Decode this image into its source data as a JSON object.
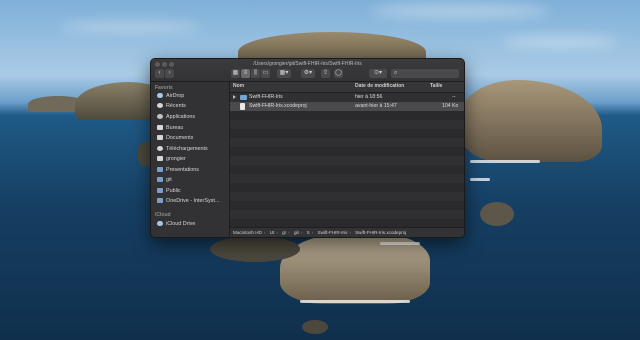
{
  "window": {
    "title": "/Users/grongier/git/Swift-FHIR-Iris/Swift-FHIR-Iris"
  },
  "sidebar": {
    "favorites_header": "Favoris",
    "favorites": [
      {
        "label": "AirDrop",
        "icon": "airdrop-icon"
      },
      {
        "label": "Récents",
        "icon": "clock-icon"
      },
      {
        "label": "Applications",
        "icon": "applications-icon"
      },
      {
        "label": "Bureau",
        "icon": "desktop-icon"
      },
      {
        "label": "Documents",
        "icon": "document-icon"
      },
      {
        "label": "Téléchargements",
        "icon": "download-icon"
      },
      {
        "label": "grongier",
        "icon": "home-icon"
      },
      {
        "label": "Presentations",
        "icon": "folder-icon"
      },
      {
        "label": "git",
        "icon": "folder-icon"
      },
      {
        "label": "Public",
        "icon": "folder-icon"
      },
      {
        "label": "OneDrive - InterSyst...",
        "icon": "cloud-icon"
      }
    ],
    "icloud_header": "iCloud",
    "icloud": [
      {
        "label": "iCloud Drive",
        "icon": "cloud-icon"
      }
    ]
  },
  "columns": {
    "name": "Nom",
    "date": "Date de modification",
    "size": "Taille"
  },
  "files": [
    {
      "name": "Swift-FHIR-Iris",
      "date": "hier à 18:56",
      "size": "--",
      "type": "folder"
    },
    {
      "name": "Swift-FHIR-Iris.xcodeproj",
      "date": "avant-hier à 15:47",
      "size": "104 Ko",
      "type": "file"
    }
  ],
  "pathbar": [
    "Macintosh HD",
    "Ut",
    "gr",
    "git",
    "S",
    "Swift-FHIR-Iris",
    "Swift-FHIR-Iris.xcodeproj"
  ]
}
